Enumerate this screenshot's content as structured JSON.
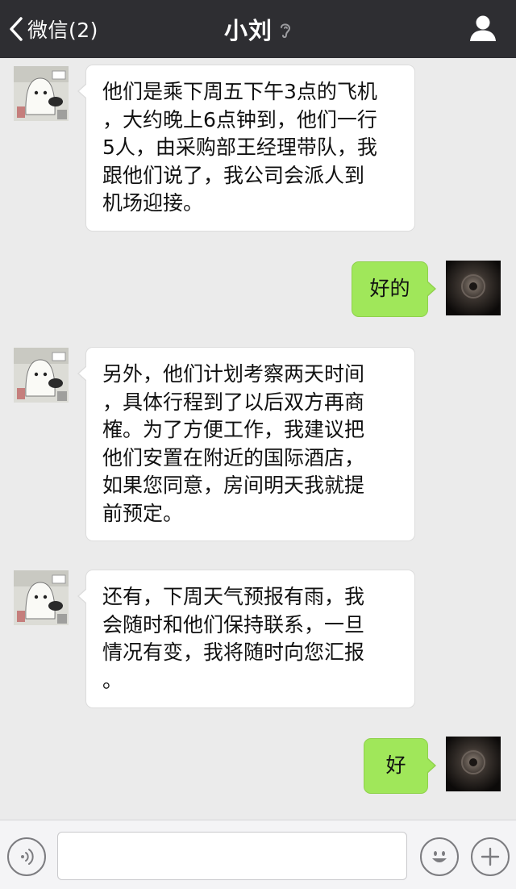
{
  "header": {
    "back_label": "微信(2)",
    "title": "小刘",
    "background": "#2e2e32"
  },
  "messages": [
    {
      "sender": "contact",
      "lines": [
        "他们是乘下周五下午3点的飞机",
        "，大约晚上6点钟到，他们一行",
        "5人，由采购部王经理带队，我",
        "跟他们说了，我公司会派人到",
        "机场迎接。"
      ]
    },
    {
      "sender": "me",
      "lines": [
        "好的"
      ]
    },
    {
      "sender": "contact",
      "lines": [
        "另外，他们计划考察两天时间",
        "，具体行程到了以后双方再商",
        "榷。为了方便工作，我建议把",
        "他们安置在附近的国际酒店，",
        "如果您同意，房间明天我就提",
        "前预定。"
      ]
    },
    {
      "sender": "contact",
      "lines": [
        "还有，下周天气预报有雨，我",
        "会随时和他们保持联系，一旦",
        "情况有变，我将随时向您汇报",
        "。"
      ]
    },
    {
      "sender": "me",
      "lines": [
        "好"
      ]
    }
  ],
  "input_bar": {
    "message_value": "",
    "voice_icon": "voice-icon",
    "emoji_icon": "emoji-icon",
    "plus_icon": "plus-icon"
  },
  "colors": {
    "background": "#ebebeb",
    "incoming_bubble": "#ffffff",
    "outgoing_bubble": "#a0e75a"
  }
}
